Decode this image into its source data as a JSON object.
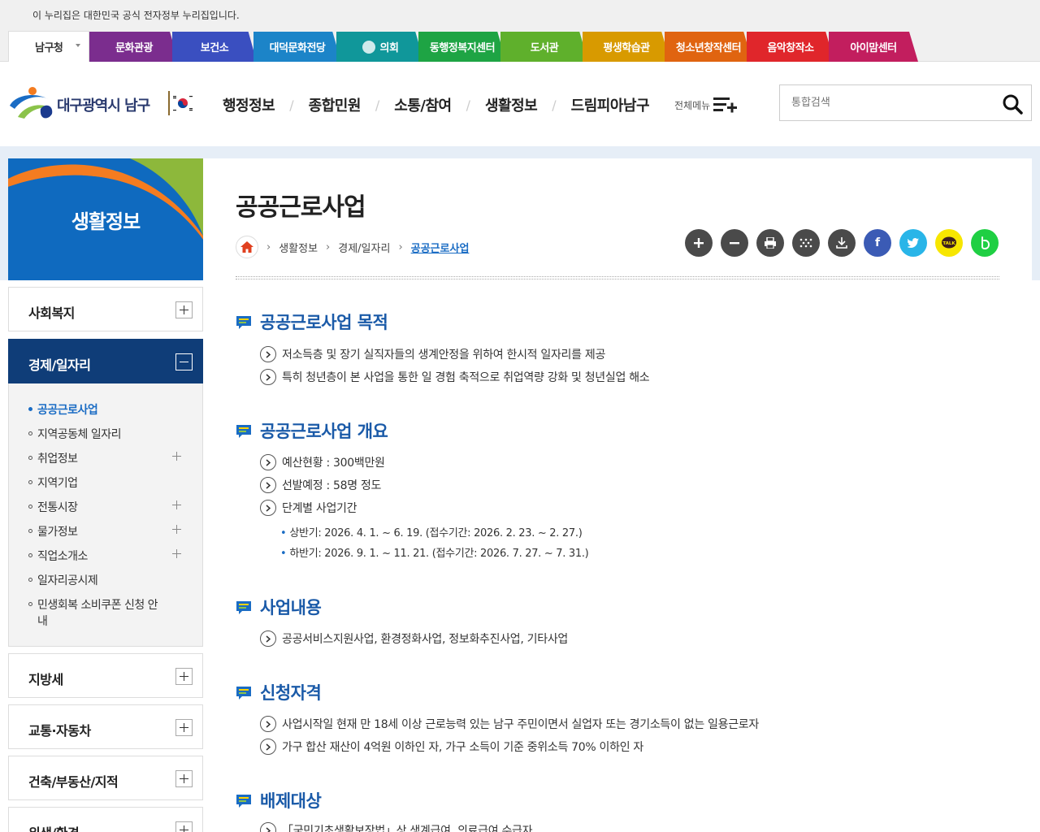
{
  "notice": "이 누리집은 대한민국 공식 전자정부 누리집입니다.",
  "tabs": [
    {
      "label": "남구청",
      "color": "#ffffff"
    },
    {
      "label": "문화관광",
      "color": "#7b2d8e"
    },
    {
      "label": "보건소",
      "color": "#3a4fc0"
    },
    {
      "label": "대덕문화전당",
      "color": "#1c84c8"
    },
    {
      "label": "의회",
      "color": "#10979a"
    },
    {
      "label": "동행정복지센터",
      "color": "#1ea444"
    },
    {
      "label": "도서관",
      "color": "#5fb02c"
    },
    {
      "label": "평생학습관",
      "color": "#d89a00"
    },
    {
      "label": "청소년창작센터",
      "color": "#e06410"
    },
    {
      "label": "음악창작소",
      "color": "#e0262b"
    },
    {
      "label": "아이맘센터",
      "color": "#c21e5e"
    }
  ],
  "header": {
    "logo_text": "대구광역시 남구",
    "gnb": [
      "행정정보",
      "종합민원",
      "소통/참여",
      "생활정보",
      "드림피아남구"
    ],
    "allmenu": "전체메뉴",
    "search_placeholder": "통합검색"
  },
  "lnb": {
    "title": "생활정보",
    "top_items": [
      "사회복지",
      "경제/일자리"
    ],
    "sub_items": [
      {
        "label": "공공근로사업",
        "on": true,
        "plus": false
      },
      {
        "label": "지역공동체 일자리",
        "on": false,
        "plus": false
      },
      {
        "label": "취업정보",
        "on": false,
        "plus": true
      },
      {
        "label": "지역기업",
        "on": false,
        "plus": false
      },
      {
        "label": "전통시장",
        "on": false,
        "plus": true
      },
      {
        "label": "물가정보",
        "on": false,
        "plus": true
      },
      {
        "label": "직업소개소",
        "on": false,
        "plus": true
      },
      {
        "label": "일자리공시제",
        "on": false,
        "plus": false
      },
      {
        "label": "민생회복 소비쿠폰 신청 안",
        "on": false,
        "plus": false
      }
    ],
    "sub_item_wrap": "내",
    "bottom_items": [
      "지방세",
      "교통·자동차",
      "건축/부동산/지적",
      "위생/환경"
    ]
  },
  "page": {
    "title": "공공근로사업",
    "breadcrumb": [
      "생활정보",
      "경제/일자리",
      "공공근로사업"
    ]
  },
  "sections": [
    {
      "title": "공공근로사업 목적",
      "lines": [
        "저소득층 및 장기 실직자들의 생계안정을 위하여 한시적 일자리를 제공",
        "특히 청년층이 본 사업을 통한 일 경험 축적으로 취업역량 강화 및 청년실업 해소"
      ]
    },
    {
      "title": "공공근로사업 개요",
      "lines": [
        "예산현황 : 300백만원",
        "선발예정 : 58명 정도",
        "단계별 사업기간"
      ],
      "sublines": [
        "상반기: 2026. 4. 1. ~ 6. 19. (접수기간: 2026. 2. 23. ~ 2. 27.)",
        "하반기: 2026. 9. 1. ~ 11. 21. (접수기간: 2026. 7. 27. ~ 7. 31.)"
      ]
    },
    {
      "title": "사업내용",
      "lines": [
        "공공서비스지원사업, 환경정화사업, 정보화추진사업, 기타사업"
      ]
    },
    {
      "title": "신청자격",
      "lines": [
        "사업시작일 현재 만 18세 이상 근로능력 있는 남구 주민이면서 실업자 또는 경기소득이 없는 일용근로자",
        "가구 합산 재산이 4억원 이하인 자, 가구 소득이 기준 중위소득 70% 이하인 자"
      ]
    },
    {
      "title": "배제대상",
      "lines": [
        "「국민기초생활보장법」상 생계급여, 의료급여 수급자"
      ]
    }
  ],
  "tools": [
    "zoom-in",
    "zoom-out",
    "print",
    "qr",
    "download",
    "facebook",
    "twitter",
    "kakaotalk",
    "band"
  ],
  "tool_text": {
    "kakao": "TALK"
  },
  "colors": {
    "primary": "#0f6abf",
    "accent": "#1a5aa8",
    "active_nav": "#0f3d78"
  }
}
